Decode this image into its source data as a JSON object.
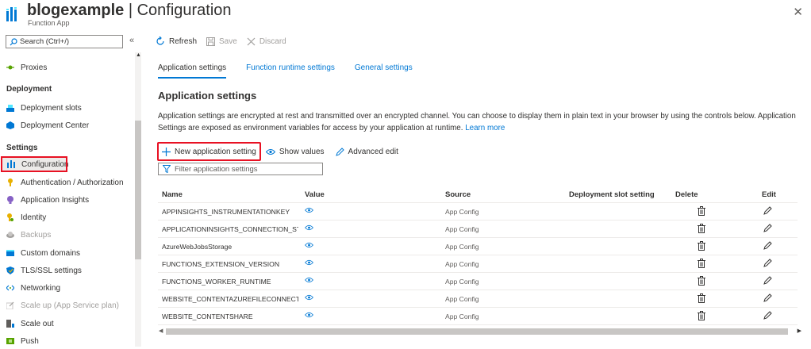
{
  "header": {
    "app_name": "blogexample",
    "separator": " | ",
    "page": "Configuration",
    "subtitle": "Function App",
    "close_icon": "close-icon"
  },
  "sidebar": {
    "search_placeholder": "Search (Ctrl+/)",
    "collapse_glyph": "«",
    "items_top": [
      {
        "label": "Proxies",
        "icon": "proxies-icon",
        "color": "#57a300"
      }
    ],
    "section_deployment": "Deployment",
    "items_deployment": [
      {
        "label": "Deployment slots",
        "icon": "slots-icon",
        "color": "#0078d4"
      },
      {
        "label": "Deployment Center",
        "icon": "deployment-center-icon",
        "color": "#0078d4"
      }
    ],
    "section_settings": "Settings",
    "items_settings": [
      {
        "label": "Configuration",
        "icon": "configuration-icon",
        "color": "#0078d4"
      },
      {
        "label": "Authentication / Authorization",
        "icon": "key-icon",
        "color": "#e8b000"
      },
      {
        "label": "Application Insights",
        "icon": "insights-icon",
        "color": "#8661c5"
      },
      {
        "label": "Identity",
        "icon": "identity-icon",
        "color": "#e8b000"
      },
      {
        "label": "Backups",
        "icon": "backups-icon",
        "color": "#a19f9d"
      },
      {
        "label": "Custom domains",
        "icon": "domains-icon",
        "color": "#0078d4"
      },
      {
        "label": "TLS/SSL settings",
        "icon": "shield-icon",
        "color": "#0078d4"
      },
      {
        "label": "Networking",
        "icon": "networking-icon",
        "color": "#0078d4"
      },
      {
        "label": "Scale up (App Service plan)",
        "icon": "scale-up-icon",
        "color": "#a19f9d"
      },
      {
        "label": "Scale out",
        "icon": "scale-out-icon",
        "color": "#0078d4"
      },
      {
        "label": "Push",
        "icon": "push-icon",
        "color": "#57a300"
      }
    ]
  },
  "toolbar": {
    "refresh": "Refresh",
    "save": "Save",
    "discard": "Discard"
  },
  "tabs": [
    "Application settings",
    "Function runtime settings",
    "General settings"
  ],
  "main": {
    "section_title": "Application settings",
    "description": "Application settings are encrypted at rest and transmitted over an encrypted channel. You can choose to display them in plain text in your browser by using the controls below. Application Settings are exposed as environment variables for access by your application at runtime.",
    "learn_more": "Learn more",
    "new_setting": "New application setting",
    "show_values": "Show values",
    "advanced_edit": "Advanced edit",
    "filter_placeholder": "Filter application settings"
  },
  "grid": {
    "columns": [
      "Name",
      "Value",
      "Source",
      "Deployment slot setting",
      "Delete",
      "Edit"
    ],
    "rows": [
      {
        "name": "APPINSIGHTS_INSTRUMENTATIONKEY",
        "value": "Hidden value. Click to show value",
        "source": "App Config"
      },
      {
        "name": "APPLICATIONINSIGHTS_CONNECTION_STRIN",
        "value": "Hidden value. Click to show value",
        "source": "App Config"
      },
      {
        "name": "AzureWebJobsStorage",
        "value": "Hidden value. Click to show value",
        "source": "App Config"
      },
      {
        "name": "FUNCTIONS_EXTENSION_VERSION",
        "value": "Hidden value. Click to show value",
        "source": "App Config"
      },
      {
        "name": "FUNCTIONS_WORKER_RUNTIME",
        "value": "Hidden value. Click to show value",
        "source": "App Config"
      },
      {
        "name": "WEBSITE_CONTENTAZUREFILECONNECTIONS",
        "value": "Hidden value. Click to show value",
        "source": "App Config"
      },
      {
        "name": "WEBSITE_CONTENTSHARE",
        "value": "Hidden value. Click to show value",
        "source": "App Config"
      }
    ]
  },
  "colors": {
    "accent": "#0078d4",
    "highlight": "#e81123"
  }
}
